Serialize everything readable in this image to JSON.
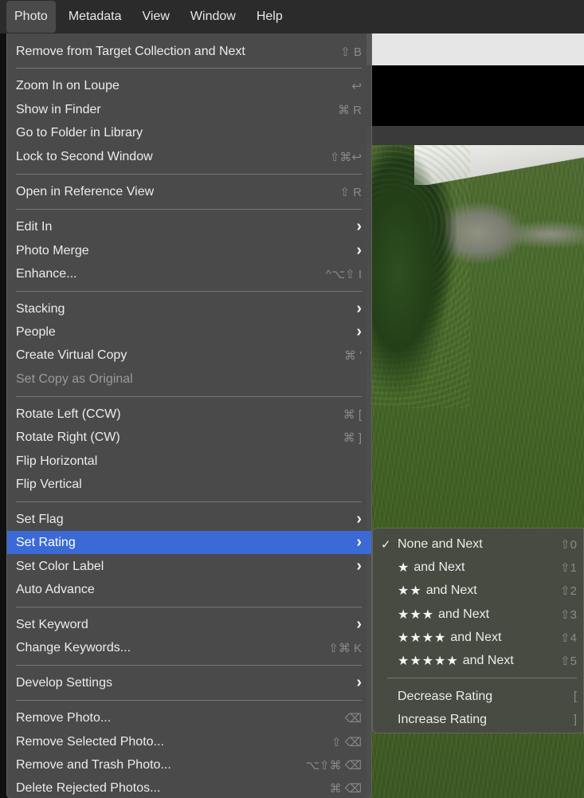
{
  "menubar": {
    "items": [
      "Photo",
      "Metadata",
      "View",
      "Window",
      "Help"
    ]
  },
  "photo_menu": {
    "items": [
      {
        "label": "Remove from Target Collection and Next",
        "shortcut": "⇧ B"
      },
      {
        "label": "Zoom In on Loupe",
        "shortcut": "↩"
      },
      {
        "label": "Show in Finder",
        "shortcut": "⌘ R"
      },
      {
        "label": "Go to Folder in Library",
        "shortcut": ""
      },
      {
        "label": "Lock to Second Window",
        "shortcut": "⇧⌘↩"
      },
      {
        "label": "Open in Reference View",
        "shortcut": "⇧ R"
      },
      {
        "label": "Edit In",
        "submenu": true
      },
      {
        "label": "Photo Merge",
        "submenu": true
      },
      {
        "label": "Enhance...",
        "shortcut": "^⌥⇧ I"
      },
      {
        "label": "Stacking",
        "submenu": true
      },
      {
        "label": "People",
        "submenu": true
      },
      {
        "label": "Create Virtual Copy",
        "shortcut": "⌘ '"
      },
      {
        "label": "Set Copy as Original",
        "shortcut": "",
        "disabled": true
      },
      {
        "label": "Rotate Left (CCW)",
        "shortcut": "⌘ ["
      },
      {
        "label": "Rotate Right (CW)",
        "shortcut": "⌘ ]"
      },
      {
        "label": "Flip Horizontal",
        "shortcut": ""
      },
      {
        "label": "Flip Vertical",
        "shortcut": ""
      },
      {
        "label": "Set Flag",
        "submenu": true
      },
      {
        "label": "Set Rating",
        "submenu": true,
        "highlighted": true
      },
      {
        "label": "Set Color Label",
        "submenu": true
      },
      {
        "label": "Auto Advance",
        "shortcut": ""
      },
      {
        "label": "Set Keyword",
        "submenu": true
      },
      {
        "label": "Change Keywords...",
        "shortcut": "⇧⌘ K"
      },
      {
        "label": "Develop Settings",
        "submenu": true
      },
      {
        "label": "Remove Photo...",
        "shortcut": "⌫"
      },
      {
        "label": "Remove Selected Photo...",
        "shortcut": "⇧ ⌫"
      },
      {
        "label": "Remove and Trash Photo...",
        "shortcut": "⌥⇧⌘ ⌫"
      },
      {
        "label": "Delete Rejected Photos...",
        "shortcut": "⌘ ⌫"
      }
    ]
  },
  "rating_submenu": {
    "items": [
      {
        "check": "✓",
        "stars": "",
        "label": "None and Next",
        "shortcut": "⇧0"
      },
      {
        "check": "",
        "stars": "★",
        "label": "and Next",
        "shortcut": "⇧1"
      },
      {
        "check": "",
        "stars": "★★",
        "label": "and Next",
        "shortcut": "⇧2"
      },
      {
        "check": "",
        "stars": "★★★",
        "label": "and Next",
        "shortcut": "⇧3"
      },
      {
        "check": "",
        "stars": "★★★★",
        "label": "and Next",
        "shortcut": "⇧4"
      },
      {
        "check": "",
        "stars": "★★★★★",
        "label": "and Next",
        "shortcut": "⇧5"
      },
      {
        "check": "",
        "stars": "",
        "label": "Decrease Rating",
        "shortcut": "["
      },
      {
        "check": "",
        "stars": "",
        "label": "Increase Rating",
        "shortcut": "]"
      }
    ]
  },
  "colors": {
    "highlight": "#3b6ad6",
    "menu_bg": "#4e4e4e",
    "menubar_bg": "#2b2b2b"
  }
}
